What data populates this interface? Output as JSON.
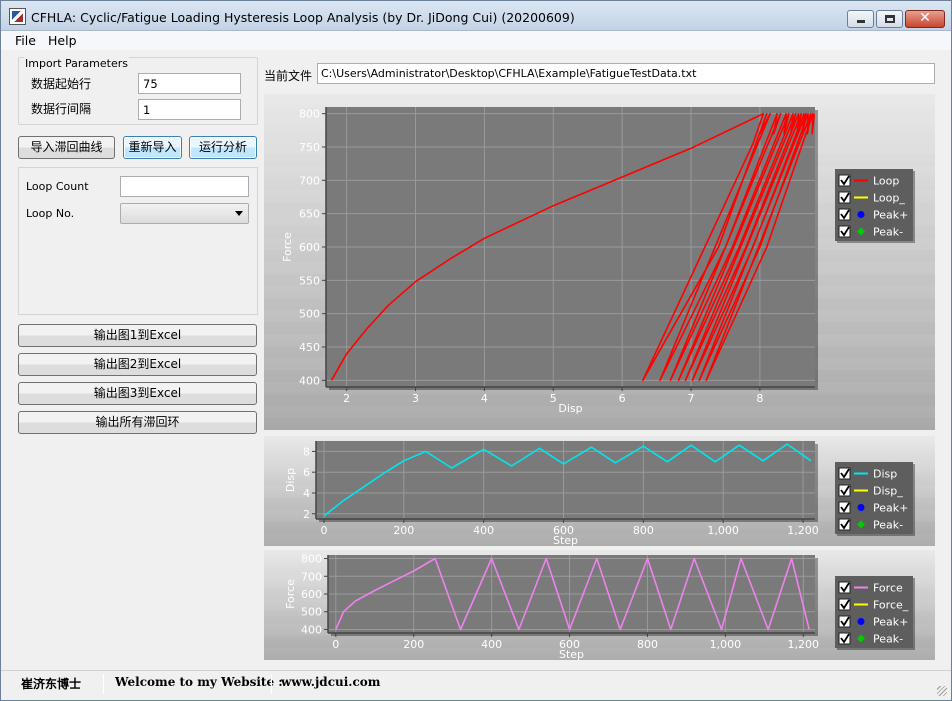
{
  "window": {
    "title": "CFHLA: Cyclic/Fatigue Loading Hysteresis Loop Analysis (by Dr. JiDong Cui) (20200609)"
  },
  "menu": [
    "File",
    "Help"
  ],
  "import_params": {
    "legend": "Import Parameters",
    "start_row_label": "数据起始行",
    "start_row_value": "75",
    "row_interval_label": "数据行间隔",
    "row_interval_value": "1"
  },
  "buttons": {
    "import_loop": "导入滞回曲线",
    "reimport": "重新导入",
    "run_analysis": "运行分析",
    "export_fig1": "输出图1到Excel",
    "export_fig2": "输出图2到Excel",
    "export_fig3": "输出图3到Excel",
    "export_all": "输出所有滞回环"
  },
  "loop_panel": {
    "loop_count_label": "Loop Count",
    "loop_count_value": "",
    "loop_no_label": "Loop No.",
    "loop_no_value": ""
  },
  "file": {
    "label": "当前文件",
    "path": "C:\\Users\\Administrator\\Desktop\\CFHLA\\Example\\FatigueTestData.txt"
  },
  "status": {
    "author": "崔济东博士",
    "welcome": "Welcome to my Website :",
    "website": "www.jdcui.com"
  },
  "colors": {
    "loop": "#ff0000",
    "disp": "#00e5ee",
    "force": "#ee82ee",
    "yellow": "#ffff00",
    "peak_plus": "#0000ff",
    "peak_minus": "#00cc00"
  },
  "chart_data": [
    {
      "type": "line",
      "title": "",
      "xlabel": "Disp",
      "ylabel": "Force",
      "xlim": [
        1.7,
        8.8
      ],
      "ylim": [
        390,
        810
      ],
      "xticks": [
        2,
        3,
        4,
        5,
        6,
        7,
        8
      ],
      "yticks": [
        400,
        450,
        500,
        550,
        600,
        650,
        700,
        750,
        800
      ],
      "legend": [
        "Loop",
        "Loop_",
        "Peak+",
        "Peak-"
      ],
      "grid": true,
      "legend_position": "right",
      "series": [
        {
          "name": "Loop",
          "x": [
            1.78,
            2.0,
            2.3,
            2.6,
            3.0,
            3.5,
            4.0,
            5.0,
            6.0,
            7.0,
            8.05,
            7.9,
            6.3,
            7.4,
            8.1,
            8.0,
            8.15,
            6.55,
            7.5,
            8.25,
            8.2,
            8.3,
            6.7,
            7.6,
            8.38,
            8.35,
            8.42,
            6.82,
            7.7,
            8.48,
            8.45,
            8.52,
            6.92,
            7.8,
            8.56,
            8.54,
            8.6,
            7.02,
            7.9,
            8.64,
            8.62,
            8.67,
            7.12,
            8.0,
            8.7,
            8.69,
            8.74,
            7.22,
            8.1,
            8.77,
            8.76,
            8.79
          ],
          "y": [
            400,
            440,
            478,
            512,
            548,
            582,
            613,
            662,
            705,
            748,
            800,
            755,
            400,
            600,
            800,
            770,
            800,
            400,
            600,
            800,
            770,
            800,
            400,
            600,
            800,
            770,
            800,
            400,
            600,
            800,
            770,
            800,
            400,
            600,
            800,
            770,
            800,
            400,
            600,
            800,
            770,
            800,
            400,
            600,
            800,
            770,
            800,
            400,
            600,
            800,
            770,
            800
          ]
        }
      ]
    },
    {
      "type": "line",
      "title": "",
      "xlabel": "Step",
      "ylabel": "Disp",
      "xlim": [
        -20,
        1230
      ],
      "ylim": [
        1.5,
        9
      ],
      "xticks": [
        0,
        200,
        400,
        600,
        800,
        1000,
        1200
      ],
      "xticklabels": [
        "0",
        "200",
        "400",
        "600",
        "800",
        "1,000",
        "1,200"
      ],
      "yticks": [
        2,
        4,
        6,
        8
      ],
      "legend": [
        "Disp",
        "Disp_",
        "Peak+",
        "Peak-"
      ],
      "grid": true,
      "legend_position": "right",
      "series": [
        {
          "name": "Disp",
          "x": [
            0,
            50,
            100,
            150,
            200,
            255,
            320,
            400,
            470,
            540,
            600,
            670,
            730,
            800,
            860,
            920,
            980,
            1040,
            1100,
            1160,
            1220
          ],
          "y": [
            1.8,
            3.3,
            4.6,
            5.9,
            7.1,
            8.0,
            6.4,
            8.2,
            6.6,
            8.3,
            6.8,
            8.4,
            6.9,
            8.5,
            7.0,
            8.6,
            7.0,
            8.6,
            7.1,
            8.7,
            7.1
          ]
        }
      ]
    },
    {
      "type": "line",
      "title": "",
      "xlabel": "Step",
      "ylabel": "Force",
      "xlim": [
        -20,
        1230
      ],
      "ylim": [
        380,
        820
      ],
      "xticks": [
        0,
        200,
        400,
        600,
        800,
        1000,
        1200
      ],
      "xticklabels": [
        "0",
        "200",
        "400",
        "600",
        "800",
        "1,000",
        "1,200"
      ],
      "yticks": [
        400,
        500,
        600,
        700,
        800
      ],
      "legend": [
        "Force",
        "Force_",
        "Peak+",
        "Peak-"
      ],
      "grid": true,
      "legend_position": "right",
      "series": [
        {
          "name": "Force",
          "x": [
            0,
            20,
            50,
            100,
            150,
            200,
            255,
            320,
            400,
            470,
            540,
            600,
            670,
            730,
            800,
            860,
            920,
            990,
            1040,
            1110,
            1170,
            1215
          ],
          "y": [
            400,
            500,
            560,
            620,
            675,
            730,
            800,
            400,
            800,
            400,
            800,
            400,
            800,
            400,
            800,
            400,
            800,
            400,
            800,
            400,
            800,
            400
          ]
        }
      ]
    }
  ]
}
